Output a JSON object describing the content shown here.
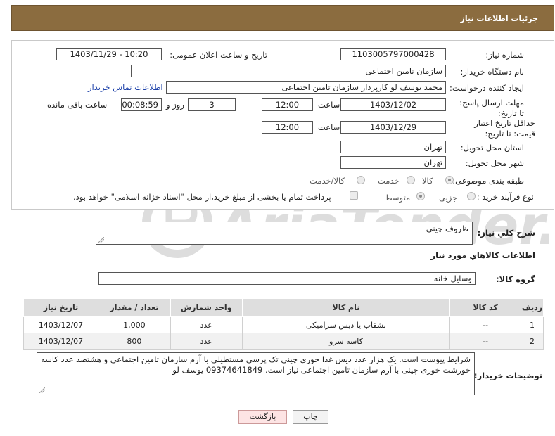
{
  "header": {
    "title": "جزئیات اطلاعات نیاز"
  },
  "fields": {
    "need_number_label": "شماره نیاز:",
    "need_number": "1103005797000428",
    "announce_label": "تاریخ و ساعت اعلان عمومی:",
    "announce_value": "1403/11/29 - 10:20",
    "buyer_org_label": "نام دستگاه خریدار:",
    "buyer_org": "سازمان تامین اجتماعی",
    "creator_label": "ایجاد کننده درخواست:",
    "creator": "محمد یوسف لو کارپرداز سازمان تامین اجتماعی",
    "contact_link": "اطلاعات تماس خریدار",
    "deadline_label": "مهلت ارسال پاسخ: تا تاریخ:",
    "deadline_date": "1403/12/02",
    "time_label": "ساعت",
    "deadline_time": "12:00",
    "days_value": "3",
    "days_label": "روز و",
    "remaining_time": "00:08:59",
    "remaining_label": "ساعت باقی مانده",
    "validity_label": "حداقل تاریخ اعتبار قیمت: تا تاریخ:",
    "validity_date": "1403/12/29",
    "validity_time": "12:00",
    "province_label": "استان محل تحویل:",
    "province": "تهران",
    "city_label": "شهر محل تحویل:",
    "city": "تهران",
    "category_label": "طبقه بندی موضوعی:",
    "category_options": [
      "کالا",
      "خدمت",
      "کالا/خدمت"
    ],
    "process_label": "نوع فرآیند خرید :",
    "process_options": [
      "جزیی",
      "متوسط"
    ],
    "payment_note": "پرداخت تمام یا بخشی از مبلغ خرید،از محل \"اسناد خزانه اسلامی\" خواهد بود."
  },
  "summary": {
    "label": "شرح كلي نياز:",
    "value": "ظروف چینی"
  },
  "goods_section": {
    "title": "اطلاعات كالاهاي مورد نياز",
    "group_label": "گروه کالا:",
    "group_value": "وسایل خانه"
  },
  "table": {
    "headers": [
      "ردیف",
      "کد کالا",
      "نام کالا",
      "واحد شمارش",
      "تعداد / مقدار",
      "تاریخ نیاز"
    ],
    "rows": [
      [
        "1",
        "--",
        "بشقاب یا دیس سرامیکی",
        "عدد",
        "1,000",
        "1403/12/07"
      ],
      [
        "2",
        "--",
        "کاسه سرو",
        "عدد",
        "800",
        "1403/12/07"
      ]
    ]
  },
  "buyer_notes": {
    "label": "توضیحات خریدار:",
    "value": "شرایط پیوست است. یک هزار عدد دیس غذا خوری چینی تک پرسی مستطیلی با آرم سازمان تامین اجتماعی و هشتصد عدد کاسه خورشت خوری چینی با آرم سازمان تامین اجتماعی نیاز است. 09374641849 یوسف لو"
  },
  "buttons": {
    "print": "چاپ",
    "back": "بازگشت"
  },
  "watermark": {
    "text": "AriaTender.neT"
  },
  "colors": {
    "header_bg": "#8b6c3f",
    "link": "#1a3fa8",
    "back_btn_bg": "#fde4e4"
  }
}
